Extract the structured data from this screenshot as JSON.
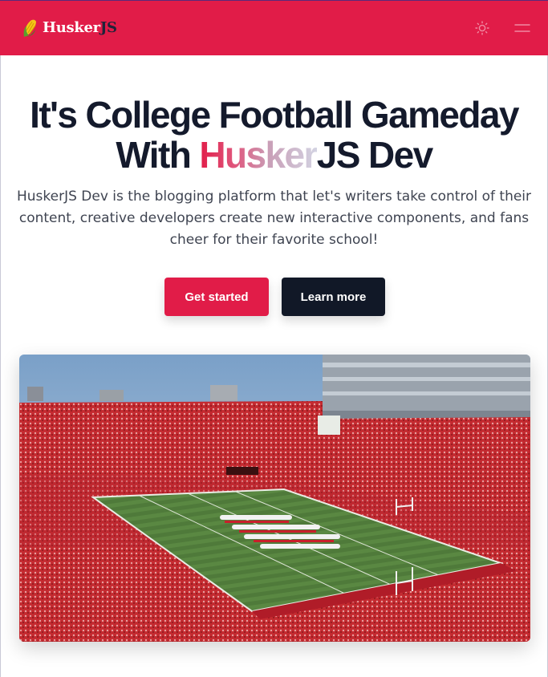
{
  "header": {
    "brand_part1": "Husker",
    "brand_part2": "JS",
    "logo_icon": "corn-icon",
    "theme_toggle_icon": "sun-icon",
    "menu_icon": "hamburger-menu-icon"
  },
  "hero": {
    "headline_line1": "It's College Football Gameday",
    "headline_with": "With ",
    "headline_highlight": "Husker",
    "headline_end": "JS Dev",
    "subtitle": "HuskerJS Dev is the blogging platform that let's writers take control of their content, creative developers create new interactive components, and fans cheer for their favorite school!",
    "primary_button": "Get started",
    "secondary_button": "Learn more",
    "image": "stadium-photo"
  },
  "colors": {
    "accent": "#e11c48",
    "dark": "#111827",
    "text": "#141a2c"
  }
}
